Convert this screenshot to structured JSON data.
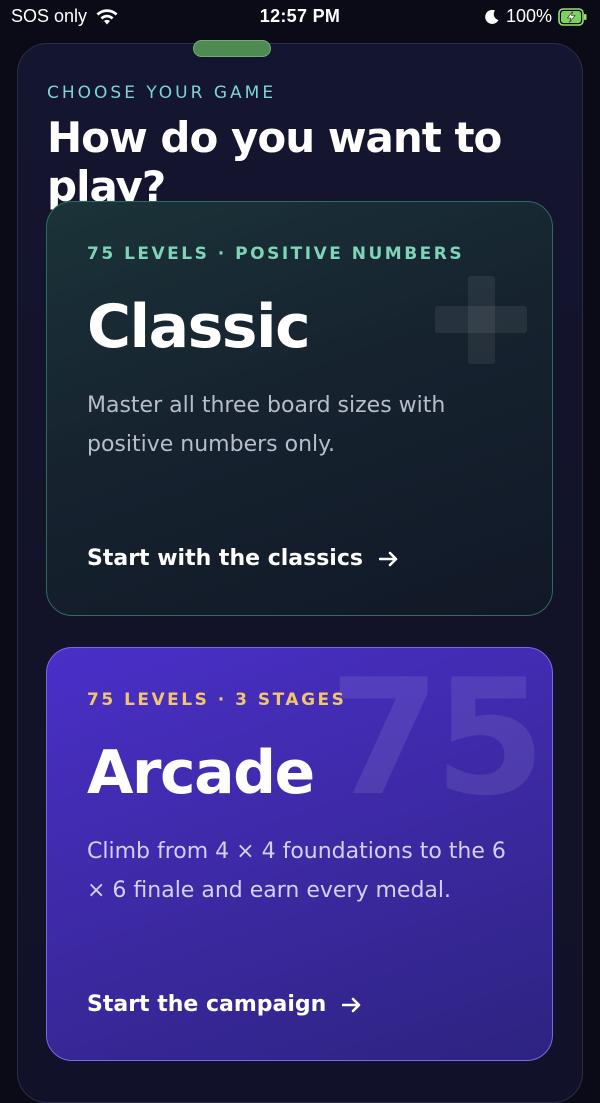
{
  "status_bar": {
    "carrier": "SOS only",
    "time": "12:57 PM",
    "battery": "100%"
  },
  "header": {
    "eyebrow": "CHOOSE YOUR GAME",
    "title": "How do you want to play?"
  },
  "cards": [
    {
      "meta": "75 LEVELS · POSITIVE NUMBERS",
      "title": "Classic",
      "description": "Master all three board sizes with positive numbers only.",
      "cta": "Start with the classics",
      "decoration": "+"
    },
    {
      "meta": "75 LEVELS · 3 STAGES",
      "title": "Arcade",
      "description": "Climb from 4 × 4 foundations to the 6 × 6 finale and earn every medal.",
      "cta": "Start the campaign",
      "decoration": "75"
    }
  ],
  "colors": {
    "background": "#0a0b17",
    "classic_accent": "#7fd4b8",
    "arcade_accent": "#f2c66b",
    "arcade_bg": "#4a2fc8",
    "grabber": "#4f8a52"
  }
}
